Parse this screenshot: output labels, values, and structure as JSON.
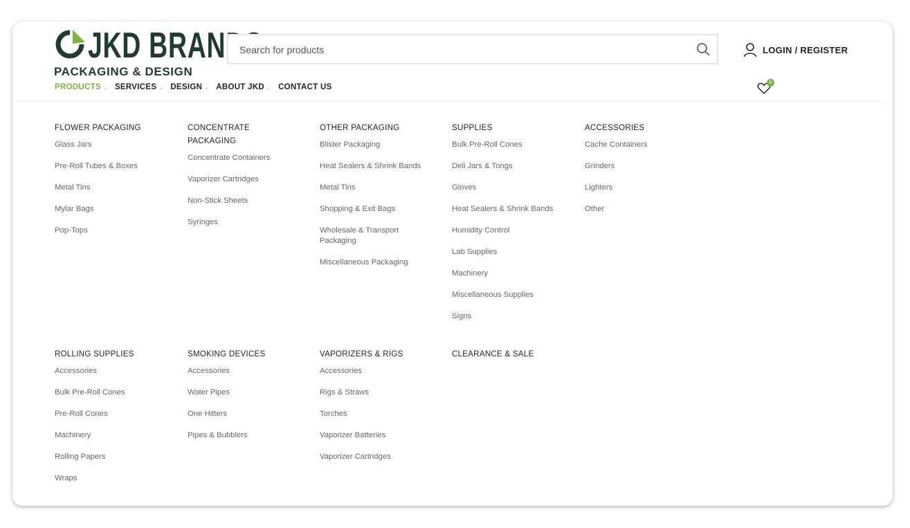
{
  "brand": {
    "name": "JKD BRANDS",
    "tagline": "PACKAGING & DESIGN",
    "colors": {
      "dark": "#1f3b32",
      "accent": "#7cb342"
    }
  },
  "search": {
    "placeholder": "Search for products",
    "value": "",
    "icon": "search-icon"
  },
  "account": {
    "label": "LOGIN / REGISTER",
    "icon": "user-icon"
  },
  "wishlist": {
    "icon": "heart-icon",
    "count": "0"
  },
  "nav": [
    {
      "label": "PRODUCTS",
      "active": true,
      "dropdown": true
    },
    {
      "label": "SERVICES",
      "active": false,
      "dropdown": true
    },
    {
      "label": "DESIGN",
      "active": false,
      "dropdown": true
    },
    {
      "label": "ABOUT JKD",
      "active": false,
      "dropdown": true
    },
    {
      "label": "CONTACT US",
      "active": false,
      "dropdown": false
    }
  ],
  "menu": {
    "row1": [
      {
        "title": "FLOWER PACKAGING",
        "links": [
          "Glass Jars",
          "Pre-Roll Tubes & Boxes",
          "Metal Tins",
          "Mylar Bags",
          "Pop-Tops"
        ]
      },
      {
        "title": "CONCENTRATE PACKAGING",
        "links": [
          "Concentrate Containers",
          "Vaporizer Cartridges",
          "Non-Stick Sheets",
          "Syringes"
        ]
      },
      {
        "title": "OTHER PACKAGING",
        "links": [
          "Blister Packaging",
          "Heat Sealers & Shrink Bands",
          "Metal Tins",
          "Shopping & Exit Bags",
          "Wholesale & Transport Packaging",
          "Miscellaneous Packaging"
        ]
      },
      {
        "title": "SUPPLIES",
        "links": [
          "Bulk Pre-Roll Cones",
          "Deli Jars & Tongs",
          "Gloves",
          "Heat Sealers & Shrink Bands",
          "Humidity Control",
          "Lab Supplies",
          "Machinery",
          "Miscellaneous Supplies",
          "Signs"
        ]
      },
      {
        "title": "ACCESSORIES",
        "links": [
          "Cache Containers",
          "Grinders",
          "Lighters",
          "Other"
        ]
      }
    ],
    "row2": [
      {
        "title": "ROLLING SUPPLIES",
        "links": [
          "Accessories",
          "Bulk Pre-Roll Cones",
          "Pre-Roll Cones",
          "Machinery",
          "Rolling Papers",
          "Wraps"
        ]
      },
      {
        "title": "SMOKING DEVICES",
        "links": [
          "Accessories",
          "Water Pipes",
          "One Hitters",
          "Pipes & Bubblers"
        ]
      },
      {
        "title": "VAPORIZERS & RIGS",
        "links": [
          "Accessories",
          "Rigs & Straws",
          "Torches",
          "Vaporizer Batteries",
          "Vaporizer Cartridges"
        ]
      },
      {
        "title": "CLEARANCE & SALE",
        "links": []
      }
    ]
  }
}
